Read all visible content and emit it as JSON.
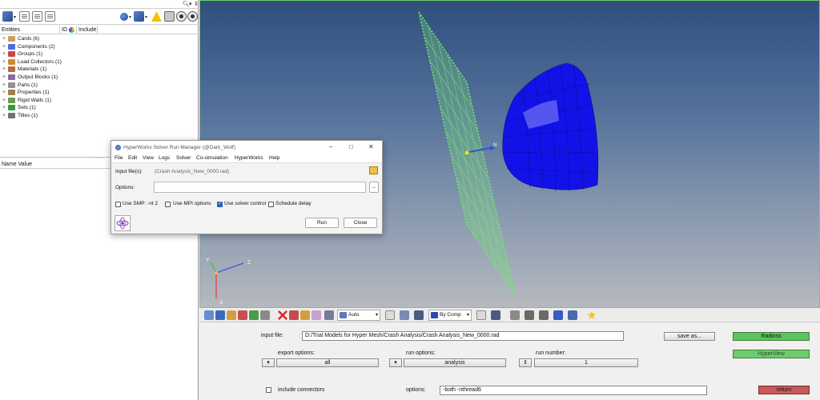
{
  "browser": {
    "search_icon": "search-icon",
    "toolbar_icons": [
      "cube-icon",
      "doc-icon",
      "doc-icon",
      "doc-icon",
      "sphere-icon",
      "cube-icon",
      "warning-icon",
      "camera-icon",
      "eye-icon"
    ],
    "columns": {
      "entities": "Entities",
      "id": "ID",
      "include": "Include"
    },
    "tree": [
      {
        "label": "Cards (6)",
        "color": "#c8a060"
      },
      {
        "label": "Components (2)",
        "color": "#4a6ee0"
      },
      {
        "label": "Groups (1)",
        "color": "#cc4444"
      },
      {
        "label": "Load Collectors (1)",
        "color": "#d08a30"
      },
      {
        "label": "Materials (1)",
        "color": "#b07040"
      },
      {
        "label": "Output Blocks (1)",
        "color": "#8a6aa0"
      },
      {
        "label": "Parts (1)",
        "color": "#909090"
      },
      {
        "label": "Properties (1)",
        "color": "#a08050"
      },
      {
        "label": "Rigid Walls (1)",
        "color": "#6a9a50"
      },
      {
        "label": "Sets (1)",
        "color": "#3a9a3a"
      },
      {
        "label": "Titles (1)",
        "color": "#707070"
      }
    ],
    "property_column": "Name Value"
  },
  "viewport": {
    "triad": {
      "x": "X",
      "y": "Y",
      "z": "Z"
    },
    "wall_label": "N"
  },
  "toolbar": {
    "auto_dropdown": "Auto",
    "by_comp_dropdown": "By Comp"
  },
  "panel": {
    "input_file_label": "input file:",
    "input_file_value": "D:/Trial Models for Hyper Mesh/Crash Analysis/Crash Analysis_New_0000.rad",
    "save_as_button": "save as...",
    "radioss_button": "Radioss",
    "hyperview_button": "HyperView",
    "export_options_label": "export options:",
    "export_options_value": "all",
    "run_options_label": "run options:",
    "run_options_value": "analysis",
    "run_number_label": "run number:",
    "run_number_value": "1",
    "include_connectors_label": "include connectors",
    "options_label": "options:",
    "options_value": "-both -nthread6",
    "return_button": "return"
  },
  "dialog": {
    "title": "HyperWorks Solver Run Manager (@Dark_Wolf)",
    "menu": [
      "File",
      "Edit",
      "View",
      "Logs",
      "Solver",
      "Co-simulation",
      "HyperWorks",
      "Help"
    ],
    "input_files_label": "Input file(s):",
    "input_files_value": "(Crash Analysis_New_0000.rad)",
    "options_label": "Options:",
    "options_value": "",
    "browse_button": "...",
    "use_smp_label": "Use SMP: -nt 2",
    "use_mpi_label": "Use MPI options",
    "use_solver_control_label": "Use solver control",
    "schedule_delay_label": "Schedule delay",
    "use_smp_checked": false,
    "use_mpi_checked": false,
    "use_solver_control_checked": true,
    "schedule_delay_checked": false,
    "run_button": "Run",
    "close_button": "Close"
  }
}
